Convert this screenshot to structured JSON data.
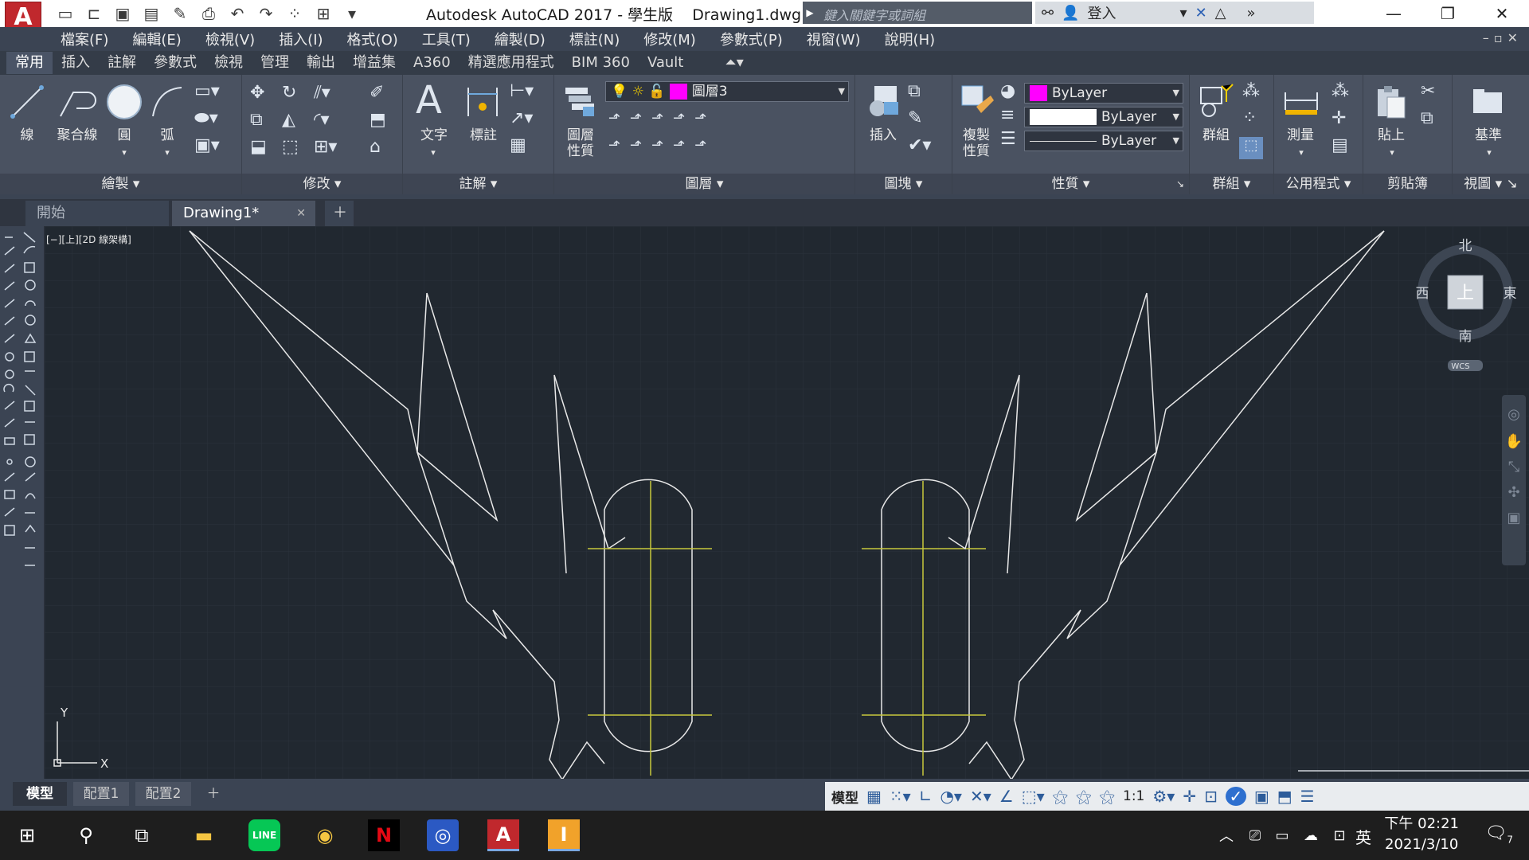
{
  "titlebar": {
    "app_logo": "A",
    "title": "Autodesk AutoCAD 2017 - 學生版    Drawing1.dwg",
    "search_placeholder": "鍵入關鍵字或詞組",
    "login_label": "登入"
  },
  "menu": {
    "items": [
      "檔案(F)",
      "編輯(E)",
      "檢視(V)",
      "插入(I)",
      "格式(O)",
      "工具(T)",
      "繪製(D)",
      "標註(N)",
      "修改(M)",
      "參數式(P)",
      "視窗(W)",
      "說明(H)"
    ]
  },
  "ribbon_tabs": [
    "常用",
    "插入",
    "註解",
    "參數式",
    "檢視",
    "管理",
    "輸出",
    "增益集",
    "A360",
    "精選應用程式",
    "BIM 360",
    "Vault"
  ],
  "ribbon": {
    "draw": {
      "panel_label": "繪製",
      "line": "線",
      "polyline": "聚合線",
      "circle": "圓",
      "arc": "弧"
    },
    "modify": {
      "panel_label": "修改"
    },
    "annotation": {
      "panel_label": "註解",
      "text": "文字",
      "dimension": "標註"
    },
    "layers": {
      "panel_label": "圖層",
      "layer_props_1": "圖層",
      "layer_props_2": "性質",
      "current_layer": "圖層3",
      "layer_color": "#ff00ff"
    },
    "block": {
      "panel_label": "圖塊",
      "insert": "插入"
    },
    "properties": {
      "panel_label": "性質",
      "match_1": "複製",
      "match_2": "性質",
      "color": "ByLayer",
      "color_swatch": "#ff00ff",
      "lineweight": "ByLayer",
      "linetype": "ByLayer"
    },
    "groups": {
      "panel_label": "群組",
      "group": "群組"
    },
    "utilities": {
      "panel_label": "公用程式",
      "measure": "測量"
    },
    "clipboard": {
      "panel_label": "剪貼簿",
      "paste": "貼上"
    },
    "view": {
      "panel_label": "視圖",
      "base": "基準"
    }
  },
  "file_tabs": {
    "start": "開始",
    "drawing": "Drawing1*"
  },
  "viewport": {
    "label": "[−][上][2D 線架構]",
    "viewcube": {
      "north": "北",
      "south": "南",
      "east": "東",
      "west": "西",
      "top": "上",
      "wcs": "WCS"
    },
    "ucs_x": "X",
    "ucs_y": "Y",
    "line_color": "#e8e8e8",
    "centerline_color": "#c8c83c",
    "background": "#212830"
  },
  "model_tabs": [
    "模型",
    "配置1",
    "配置2"
  ],
  "statusbar": {
    "model": "模型",
    "scale": "1:1"
  },
  "taskbar": {
    "time": "下午 02:21",
    "date": "2021/3/10",
    "ime": "英",
    "notifications": "7"
  }
}
